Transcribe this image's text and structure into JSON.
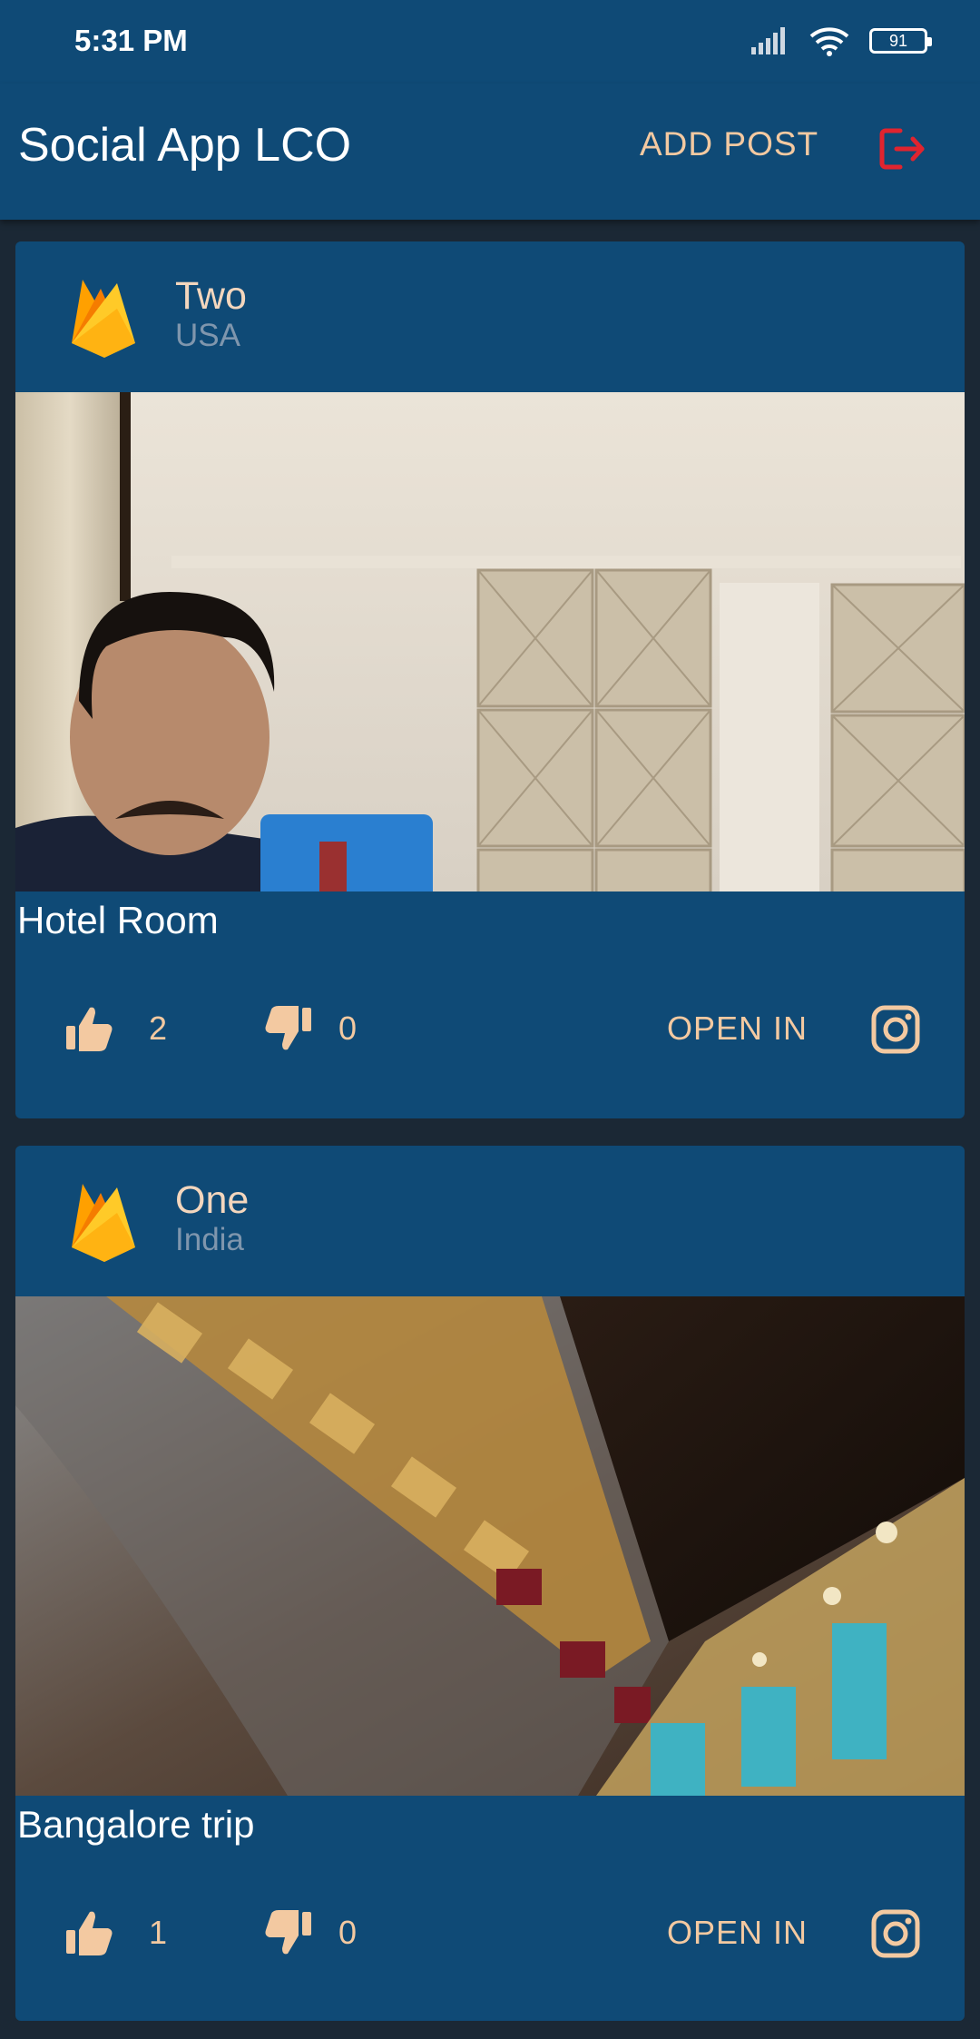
{
  "status": {
    "time": "5:31 PM",
    "battery": "91"
  },
  "app": {
    "title": "Social App LCO",
    "add_post_label": "ADD POST",
    "logout_icon": "logout-icon"
  },
  "posts": [
    {
      "author": "Two",
      "location": "USA",
      "caption": "Hotel Room",
      "likes": "2",
      "dislikes": "0",
      "open_in_label": "OPEN IN"
    },
    {
      "author": "One",
      "location": "India",
      "caption": "Bangalore trip",
      "likes": "1",
      "dislikes": "0",
      "open_in_label": "OPEN IN"
    }
  ],
  "colors": {
    "primary": "#0f4a76",
    "background": "#1b2835",
    "accent": "#f3c9a1",
    "logout": "#e0242f"
  }
}
